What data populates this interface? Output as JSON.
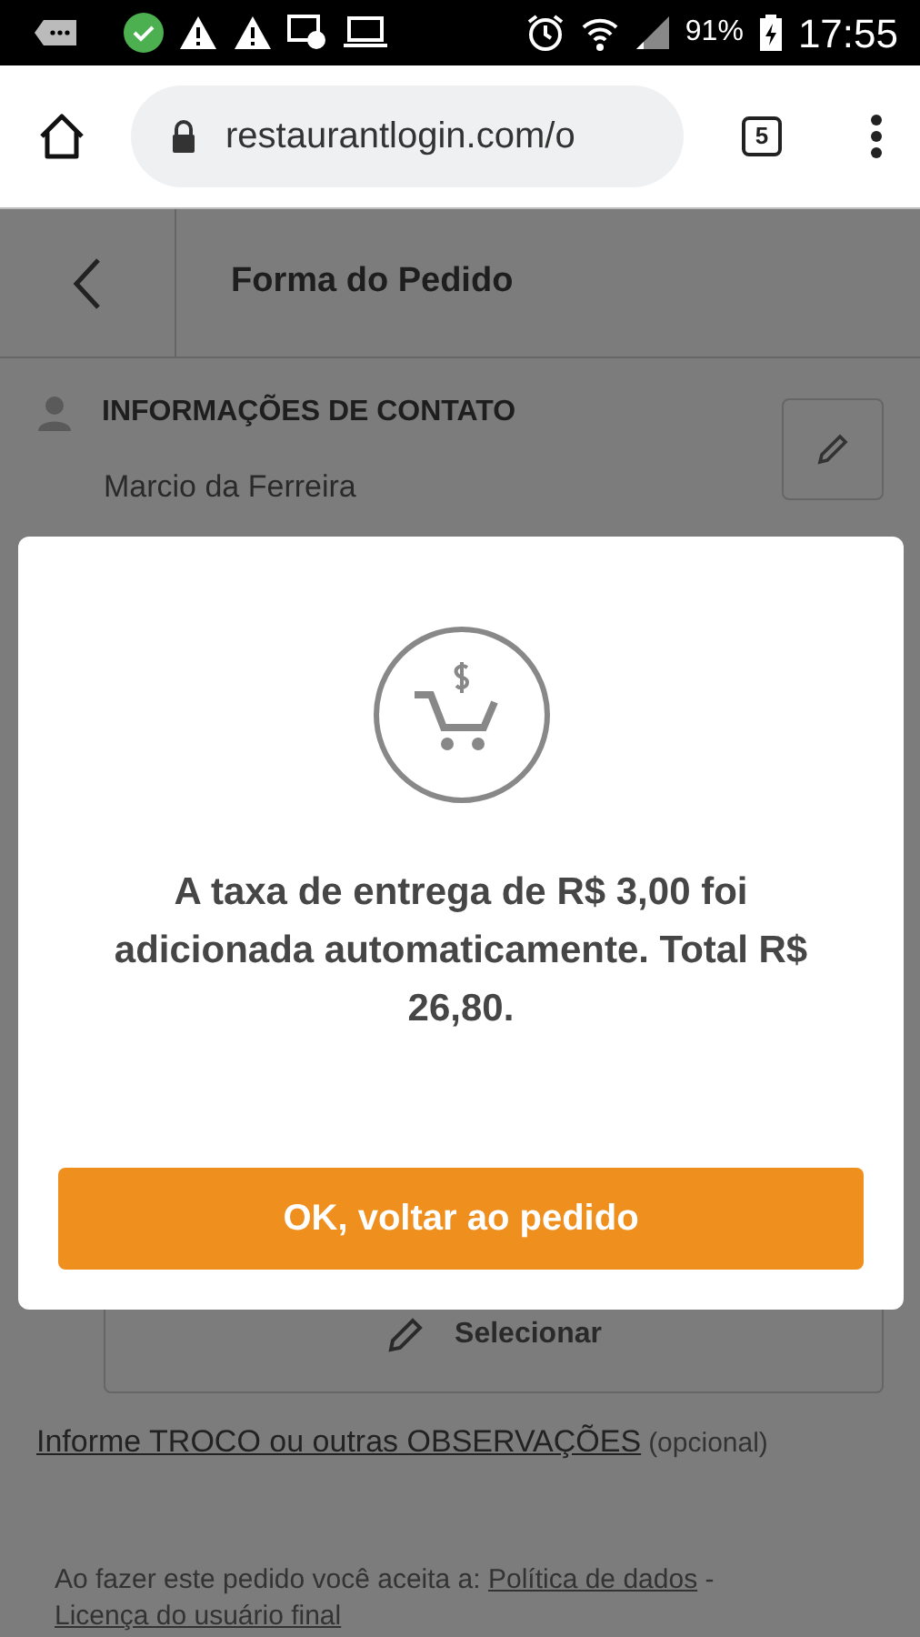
{
  "status_bar": {
    "battery": "91%",
    "time": "17:55"
  },
  "browser": {
    "url": "restaurantlogin.com/o",
    "tab_count": "5"
  },
  "header": {
    "title": "Forma do Pedido"
  },
  "contact": {
    "heading": "INFORMAÇÕES DE CONTATO",
    "name": "Marcio da Ferreira"
  },
  "select_button": {
    "label": "Selecionar"
  },
  "notes": {
    "link": "Informe TROCO ou outras OBSERVAÇÕES",
    "hint": "(opcional)"
  },
  "terms": {
    "text": "Ao fazer este pedido você aceita a:",
    "links": [
      "Política de dados",
      "Licença do usuário final"
    ],
    "separator": "-"
  },
  "modal": {
    "message": "A taxa de entrega de R$ 3,00 foi adicionada automaticamente. Total R$ 26,80.",
    "button": "OK, voltar ao pedido"
  }
}
